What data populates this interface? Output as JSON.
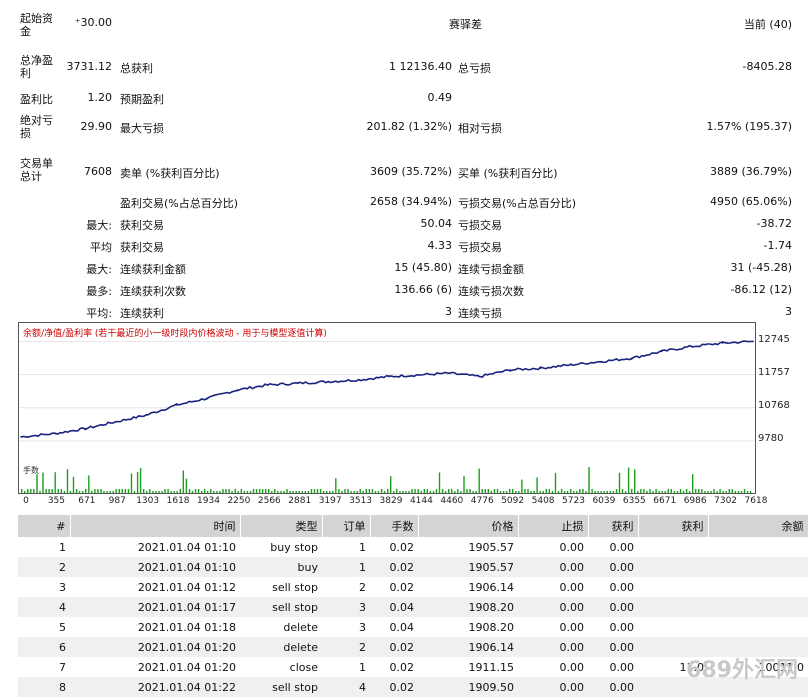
{
  "stats": {
    "initial_deposit_label": "起始资金",
    "initial_deposit_value": "⁺30.00",
    "spread_label": "赛驿差",
    "spread_value": "当前 (40)",
    "net_profit_label": "总净盈利",
    "net_profit_value": "3731.12",
    "gross_profit_label": "总获利",
    "gross_profit_value": "1 12136.40",
    "gross_loss_label": "总亏损",
    "gross_loss_value": "-8405.28",
    "profit_factor_label": "盈利比",
    "profit_factor_value": "1.20",
    "expected_payoff_label": "预期盈利",
    "expected_payoff_value": "0.49",
    "abs_drawdown_label": "绝对亏损",
    "abs_drawdown_value": "29.90",
    "max_drawdown_label": "最大亏损",
    "max_drawdown_value": "201.82 (1.32%)",
    "rel_drawdown_label": "相对亏损",
    "rel_drawdown_value": "1.57% (195.37)",
    "total_trades_label": "交易单总计",
    "total_trades_value": "7608",
    "short_label": "卖单 (%获利百分比)",
    "short_value": "3609 (35.72%)",
    "long_label": "买单 (%获利百分比)",
    "long_value": "3889 (36.79%)",
    "profit_trades_label": "盈利交易(%占总百分比)",
    "profit_trades_value": "2658 (34.94%)",
    "loss_trades_label": "亏损交易(%占总百分比)",
    "loss_trades_value": "4950 (65.06%)",
    "largest_label": "最大:",
    "largest_profit_label": "获利交易",
    "largest_profit_value": "50.04",
    "largest_loss_label": "亏损交易",
    "largest_loss_value": "-38.72",
    "average_label": "平均",
    "average_profit_label": "获利交易",
    "average_profit_value": "4.33",
    "average_loss_label": "亏损交易",
    "average_loss_value": "-1.74",
    "max_consec_label": "最大:",
    "max_consec_wins_amt_label": "连续获利金额",
    "max_consec_wins_amt_value": "15 (45.80)",
    "max_consec_loss_amt_label": "连续亏损金额",
    "max_consec_loss_amt_value": "31 (-45.28)",
    "maximal_label": "最多:",
    "maximal_wins_label": "连续获利次数",
    "maximal_wins_value": "136.66 (6)",
    "maximal_loss_label": "连续亏损次数",
    "maximal_loss_value": "-86.12 (12)",
    "avg_consec_label": "平均:",
    "avg_consec_wins_label": "连续获利",
    "avg_consec_wins_value": "3",
    "avg_consec_loss_label": "连续亏损",
    "avg_consec_loss_value": "3"
  },
  "chart": {
    "note": "余额/净值/盈利率 (若干最近的小一级时段内价格波动 - 用于与模型逐值计算)",
    "volume_label": "手数",
    "y_ticks": [
      "12745",
      "11757",
      "10768",
      "9780"
    ],
    "y_tick_values": [
      12745,
      11757,
      10768,
      9780
    ],
    "x_ticks": [
      "0",
      "355",
      "671",
      "987",
      "1303",
      "1618",
      "1934",
      "2250",
      "2566",
      "2881",
      "3197",
      "3513",
      "3829",
      "4144",
      "4460",
      "4776",
      "5092",
      "5408",
      "5723",
      "6039",
      "6355",
      "6671",
      "6986",
      "7302",
      "7618"
    ],
    "line_color": "#1a237e",
    "volume_color": "#1aa01a"
  },
  "chart_data": {
    "type": "line",
    "xlabel": "",
    "ylabel": "",
    "ylim": [
      9300,
      13000
    ],
    "x": [
      0,
      355,
      671,
      987,
      1303,
      1618,
      1934,
      2250,
      2566,
      2881,
      3197,
      3513,
      3829,
      4144,
      4460,
      4776,
      5092,
      5408,
      5723,
      6039,
      6355,
      6671,
      6986,
      7302,
      7618
    ],
    "series": [
      {
        "values": [
          9900,
          10000,
          10150,
          10350,
          10550,
          10850,
          11050,
          11300,
          11450,
          11500,
          11550,
          11600,
          11700,
          11750,
          11800,
          11700,
          11900,
          11950,
          12050,
          12150,
          12250,
          12450,
          12600,
          12700,
          12750
        ]
      }
    ]
  },
  "table": {
    "headers": [
      "#",
      "时间",
      "类型",
      "订单",
      "手数",
      "价格",
      "止损",
      "获利",
      "获利",
      "余额"
    ],
    "rows": [
      [
        "1",
        "2021.01.04 01:10",
        "buy stop",
        "1",
        "0.02",
        "1905.57",
        "0.00",
        "0.00",
        "",
        ""
      ],
      [
        "2",
        "2021.01.04 01:10",
        "buy",
        "1",
        "0.02",
        "1905.57",
        "0.00",
        "0.00",
        "",
        ""
      ],
      [
        "3",
        "2021.01.04 01:12",
        "sell stop",
        "2",
        "0.02",
        "1906.14",
        "0.00",
        "0.00",
        "",
        ""
      ],
      [
        "4",
        "2021.01.04 01:17",
        "sell stop",
        "3",
        "0.04",
        "1908.20",
        "0.00",
        "0.00",
        "",
        ""
      ],
      [
        "5",
        "2021.01.04 01:18",
        "delete",
        "3",
        "0.04",
        "1908.20",
        "0.00",
        "0.00",
        "",
        ""
      ],
      [
        "6",
        "2021.01.04 01:20",
        "delete",
        "2",
        "0.02",
        "1906.14",
        "0.00",
        "0.00",
        "",
        ""
      ],
      [
        "7",
        "2021.01.04 01:20",
        "close",
        "1",
        "0.02",
        "1911.15",
        "0.00",
        "0.00",
        "11.0",
        "10011.0"
      ],
      [
        "8",
        "2021.01.04 01:22",
        "sell stop",
        "4",
        "0.02",
        "1909.50",
        "0.00",
        "0.00",
        "",
        ""
      ]
    ]
  },
  "watermark": "689外汇网"
}
